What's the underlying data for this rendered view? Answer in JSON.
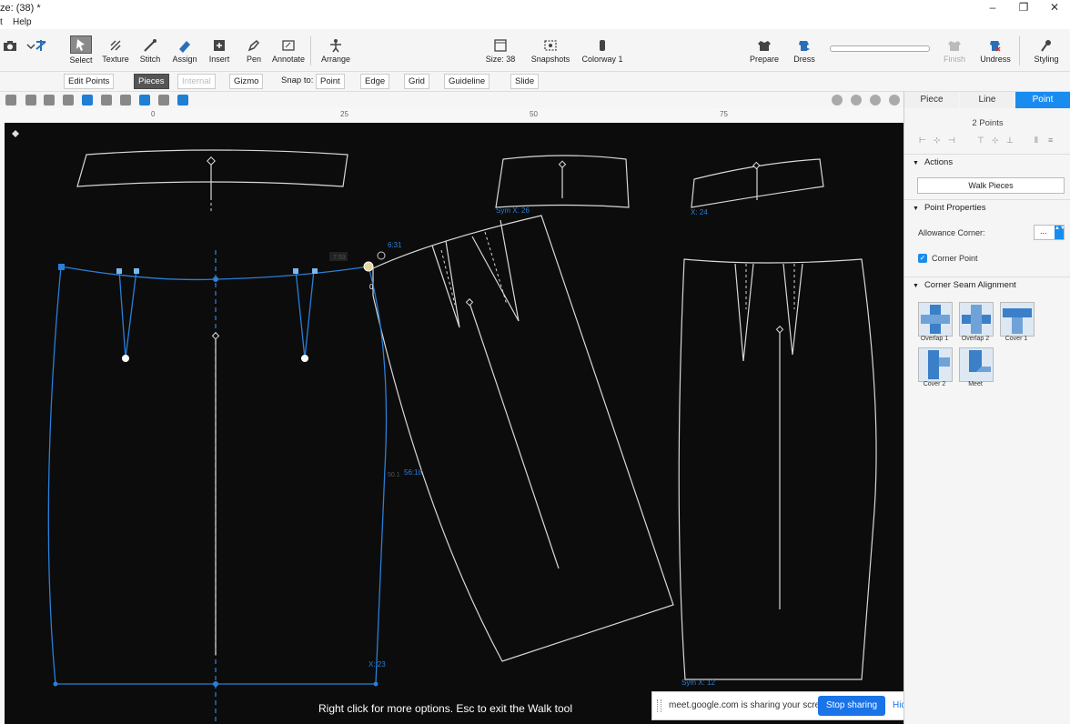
{
  "window": {
    "title_fragment": "ze: (38) *",
    "controls": [
      "–",
      "❐",
      "✕"
    ]
  },
  "menu": {
    "item1": "t",
    "item2": "Help"
  },
  "toolbar": {
    "select": "Select",
    "texture": "Texture",
    "stitch": "Stitch",
    "assign": "Assign",
    "insert": "Insert",
    "pen": "Pen",
    "annotate": "Annotate",
    "arrange": "Arrange",
    "size": "Size: 38",
    "snapshots": "Snapshots",
    "colorway": "Colorway 1",
    "prepare": "Prepare",
    "dress": "Dress",
    "finish": "Finish",
    "undress": "Undress",
    "styling": "Styling"
  },
  "subtoolbar": {
    "edit_points": "Edit Points",
    "pieces": "Pieces",
    "internal": "Internal",
    "gizmo": "Gizmo",
    "snap_to": "Snap to:",
    "point": "Point",
    "edge": "Edge",
    "grid": "Grid",
    "guideline": "Guideline",
    "slide": "Slide"
  },
  "ruler": {
    "ticks": [
      "0",
      "25",
      "50",
      "75"
    ]
  },
  "canvas": {
    "labels": {
      "sym_x_26": "Sym X: 26",
      "x_24": "X: 24",
      "x_23": "X: 23",
      "sym_x_12": "Sym X: 12",
      "measure_631": "6:31",
      "measure_5618": "56:18",
      "measure_753": "7.53",
      "measure_0": "0",
      "measure_501": "50.1"
    },
    "hint": "Right click for more options. Esc to exit the Walk tool"
  },
  "share_bar": {
    "message": "meet.google.com is sharing your screen.",
    "stop": "Stop sharing",
    "hide": "Hide"
  },
  "panel": {
    "tabs": [
      "Piece",
      "Line",
      "Point"
    ],
    "selected_tab": "Point",
    "points_count": "2 Points",
    "actions_title": "Actions",
    "walk_pieces": "Walk Pieces",
    "point_props_title": "Point Properties",
    "allowance_corner_label": "Allowance Corner:",
    "allowance_corner_value": "...",
    "corner_point_label": "Corner Point",
    "corner_seam_title": "Corner Seam Alignment",
    "seam_options": [
      "Overlap 1",
      "Overlap 2",
      "Cover 1",
      "Cover 2",
      "Meet"
    ]
  },
  "colors": {
    "accent": "#1a8cf0",
    "selection": "#2a7fd8",
    "canvas_bg": "#0c0c0c",
    "pattern_line": "#d8d8d8"
  }
}
